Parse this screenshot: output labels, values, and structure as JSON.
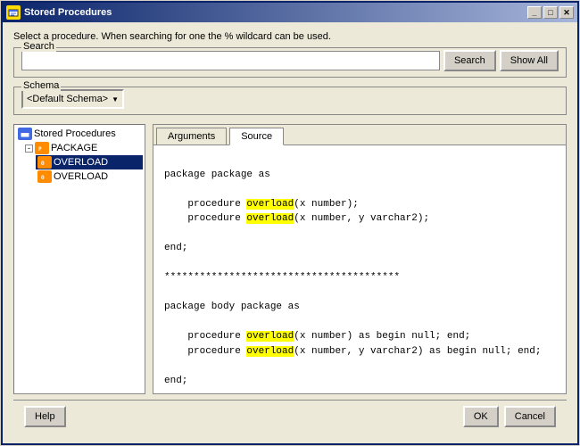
{
  "window": {
    "title": "Stored Procedures",
    "icon_label": "SP"
  },
  "description": "Select a procedure. When searching for one the % wildcard can be used.",
  "search": {
    "label": "Search",
    "placeholder": "",
    "search_btn": "Search",
    "show_all_btn": "Show All"
  },
  "schema": {
    "label": "Schema",
    "value": "<Default Schema>"
  },
  "tree": {
    "root_label": "Stored Procedures",
    "items": [
      {
        "label": "PACKAGE",
        "type": "package",
        "level": 1,
        "expanded": true
      },
      {
        "label": "OVERLOAD",
        "type": "overload_selected",
        "level": 2,
        "selected": true
      },
      {
        "label": "OVERLOAD",
        "type": "overload",
        "level": 2
      }
    ]
  },
  "tabs": [
    {
      "label": "Arguments",
      "active": false
    },
    {
      "label": "Source",
      "active": true
    }
  ],
  "code": {
    "lines": [
      "",
      "package package as",
      "",
      "    procedure overload(x number);",
      "    procedure overload(x number, y varchar2);",
      "",
      "end;",
      "",
      "****************************************",
      "",
      "package body package as",
      "",
      "    procedure overload(x number) as begin null; end;",
      "    procedure overload(x number, y varchar2) as begin null; end;",
      "",
      "end;"
    ],
    "highlight_word": "overload"
  },
  "buttons": {
    "help": "Help",
    "ok": "OK",
    "cancel": "Cancel"
  }
}
